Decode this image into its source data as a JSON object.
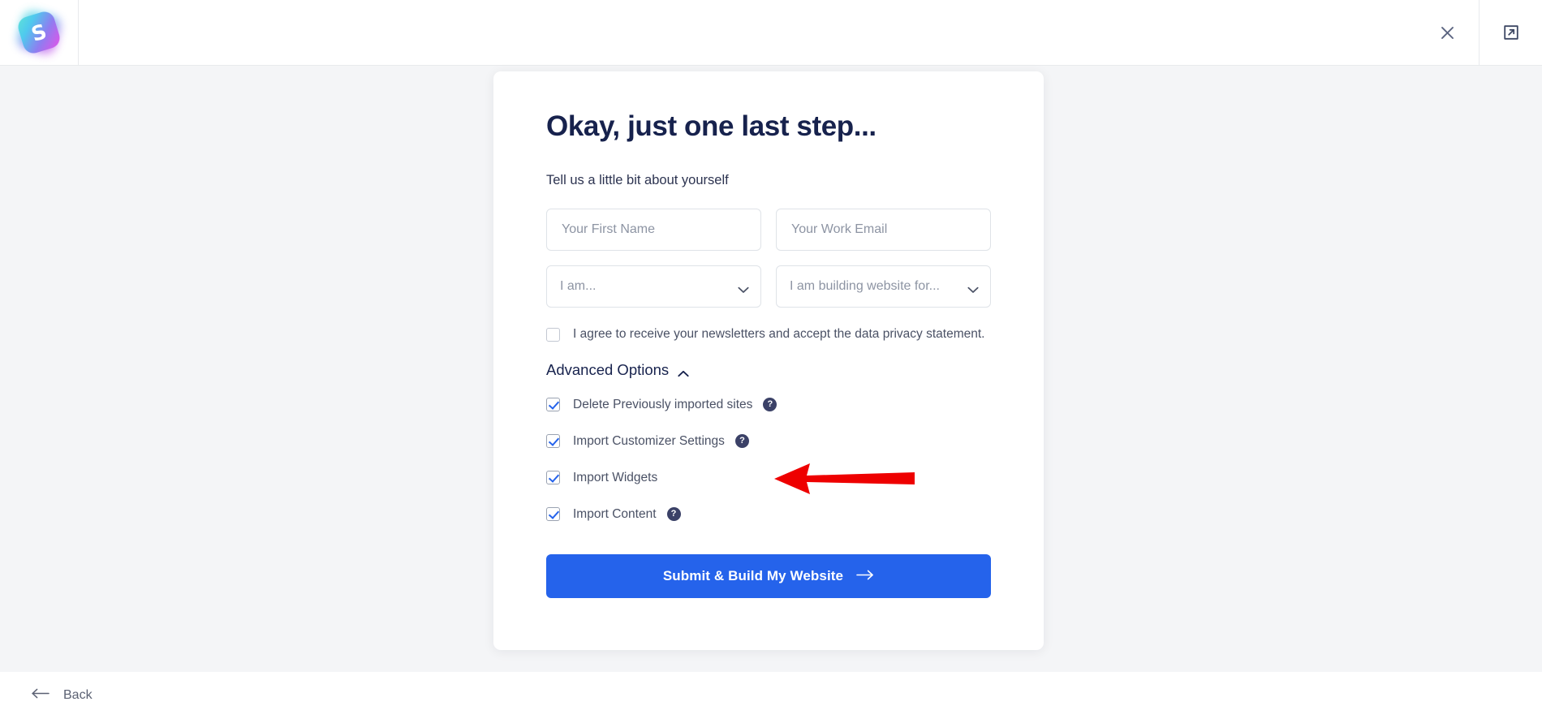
{
  "header": {
    "logo_letter": "S",
    "close_label": "",
    "external_label": ""
  },
  "card": {
    "title": "Okay, just one last step...",
    "subtitle": "Tell us a little bit about yourself",
    "fields": {
      "first_name": {
        "placeholder": "Your First Name",
        "value": ""
      },
      "work_email": {
        "placeholder": "Your Work Email",
        "value": ""
      }
    },
    "selects": {
      "role": {
        "value": "I am...",
        "options": [
          "I am..."
        ]
      },
      "purpose": {
        "value": "I am building website for...",
        "options": [
          "I am building website for..."
        ]
      }
    },
    "agreement": {
      "label": "I agree to receive your newsletters and accept the data privacy statement.",
      "checked": false
    },
    "advanced": {
      "title": "Advanced Options",
      "expanded": true,
      "options": [
        {
          "label": "Delete Previously imported sites",
          "checked": true,
          "help": "?"
        },
        {
          "label": "Import Customizer Settings",
          "checked": true,
          "help": "?"
        },
        {
          "label": "Import Widgets",
          "checked": true,
          "help": ""
        },
        {
          "label": "Import Content",
          "checked": true,
          "help": "?"
        }
      ]
    },
    "submit": {
      "label": "Submit & Build My Website",
      "arrow": "→"
    }
  },
  "footer": {
    "back_label": "Back"
  },
  "colors": {
    "accent": "#2563eb",
    "title": "#17224d",
    "page_bg": "#f4f5f7",
    "card_bg": "#ffffff",
    "annotation": "#ee0000",
    "help_bg": "#3b4167"
  }
}
